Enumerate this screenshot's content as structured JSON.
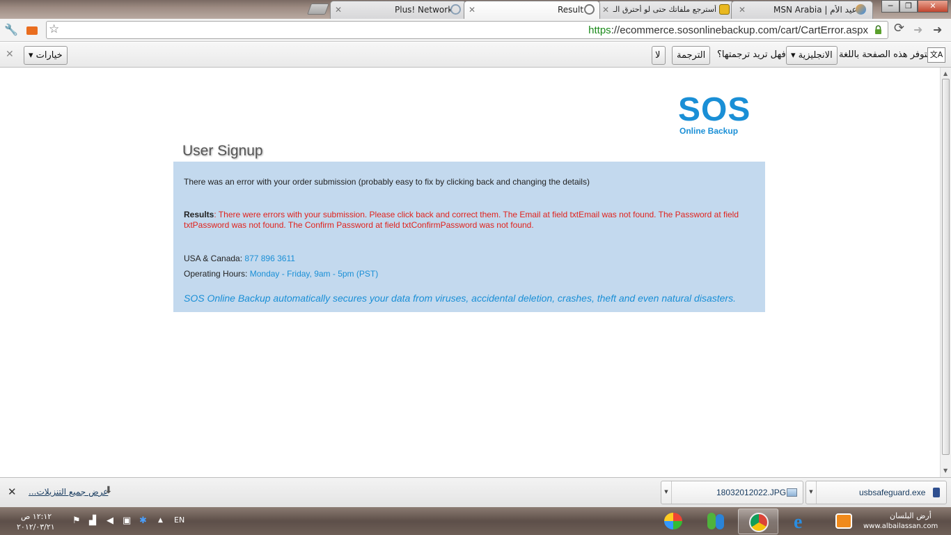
{
  "browser": {
    "tabs": [
      {
        "label": "Plus! Network",
        "active": false
      },
      {
        "label": "Result",
        "active": true
      },
      {
        "label": "أسترجع ملفاتك حتى لو أحترق الـ",
        "active": false
      },
      {
        "label": "عيد الأم | MSN Arabia",
        "active": false
      }
    ],
    "window_buttons": {
      "minimize": "─",
      "maximize": "❐",
      "close": "✕"
    },
    "url_scheme": "https",
    "url_rest": "://ecommerce.sosonlinebackup.com/cart/CartError.aspx"
  },
  "translate_bar": {
    "prompt_prefix": "تتوفر هذه الصفحة باللغة",
    "language": "الانجليزية",
    "question": "فهل تريد ترجمتها؟",
    "translate_button": "الترجمة",
    "no_button": "لا",
    "options_button": "خيارات"
  },
  "page": {
    "logo_main": "SOS",
    "logo_sub": "Online Backup",
    "heading": "User Signup",
    "error_intro": "There was an error with your order submission (probably easy to fix by clicking back and changing the details)",
    "results_label": "Results",
    "results_line1": ": There were errors with your submission. Please click back and correct them. The Email at field txtEmail was not found. The Password at field",
    "results_line2": "txtPassword was not found. The Confirm Password at field txtConfirmPassword was not found.",
    "phone_label": "USA & Canada: ",
    "phone_value": "877 896 3611",
    "hours_label": "Operating Hours: ",
    "hours_value": "Monday - Friday, 9am - 5pm (PST)",
    "tagline": "SOS Online Backup automatically secures your data from viruses, accidental deletion, crashes, theft and even natural disasters."
  },
  "downloads": {
    "show_all": "عرض جميع التنزيلات...",
    "items": [
      {
        "name": "18032012022.JPG"
      },
      {
        "name": "usbsafeguard.exe"
      }
    ]
  },
  "taskbar": {
    "language": "EN",
    "time": "١٢:١٢ ص",
    "date": "٢٠١٢/٠٣/٢١",
    "watermark_title": "أرض البلسان",
    "watermark_url": "www.albailassan.com"
  },
  "colors": {
    "link_blue": "#1a8fd6",
    "error_red": "#e0221c",
    "panel_bg": "#c3d9ee"
  }
}
